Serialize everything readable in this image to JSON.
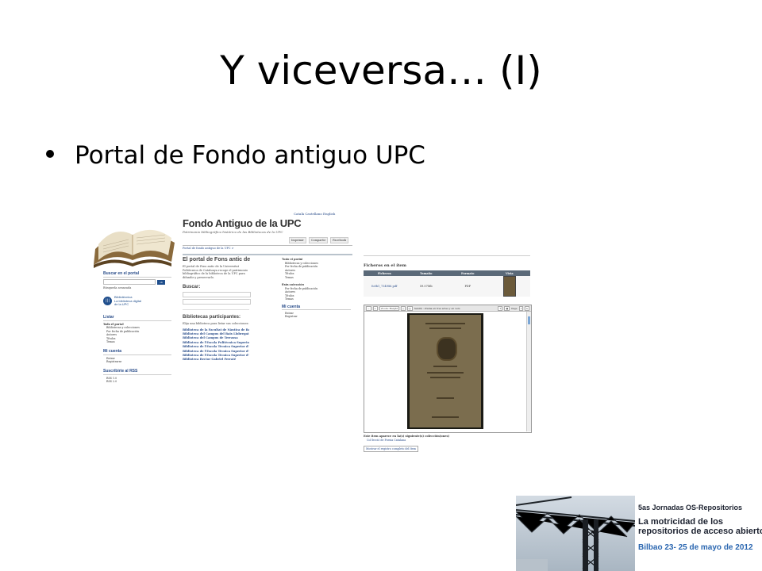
{
  "slide": {
    "title": "Y viceversa… (I)",
    "bullet": "Portal de Fondo antiguo UPC"
  },
  "portal": {
    "lang_links": "Català   Castellano   English",
    "logo_title": "Fondo Antiguo de la UPC",
    "logo_subtitle": "Patrimonio bibliográfico histórico de las Bibliotecas de la UPC",
    "social": [
      "Imprimir",
      "Compartir",
      "Facebook"
    ],
    "breadcrumb": "Portal de fondo antiguo de la UPC >",
    "left_sidebar": {
      "search_heading": "Buscar en el portal",
      "search_go": "ok",
      "advanced_search": "Búsqueda avanzada",
      "bibliotecnica_lines": [
        "Bibliotècnica",
        "La biblioteca digital",
        "de la UPC"
      ],
      "list_heading": "Listar",
      "list_items": [
        "Todo el portal",
        "Bibliotecas y colecciones",
        "Por fecha de publicación",
        "Autores",
        "Títulos",
        "Temas"
      ],
      "account_heading": "Mi cuenta",
      "account_items": [
        "Entrar",
        "Registrarse"
      ],
      "rss_heading": "Suscribirte al RSS",
      "rss_items": [
        "RSS 1.0",
        "RSS 2.0"
      ]
    },
    "main": {
      "portal_title": "El portal de Fons antic de",
      "portal_text": "El portal de Fons antic de la Universitat Politècnica de Catalunya recoge el patrimonio bibliográfico de la biblioteca de la UPC para difundir y preservarlo.",
      "search_label": "Buscar:",
      "libraries_title": "Bibliotecas participantes:",
      "libraries_intro": "Elija una biblioteca para listar sus colecciones:",
      "libraries": [
        "Biblioteca de la Facultat de Nàutica de Barcelona",
        "Biblioteca del Campus del Baix Llobregat",
        "Biblioteca del Campus de Terrassa",
        "Biblioteca de l'Escola Politècnica Superior",
        "Biblioteca de l'Escola Tècnica Superior d'Arquitectura",
        "Biblioteca de l'Escola Tècnica Superior d'Enginyeria",
        "Biblioteca de l'Escola Tècnica Superior d'Enginyers",
        "Biblioteca Rector Gabriel Ferraté"
      ]
    },
    "right_sidebar": {
      "all_heading": "Todo el portal",
      "all_items": [
        "Bibliotecas y colecciones",
        "Por fecha de publicación",
        "Autores",
        "Títulos",
        "Temas"
      ],
      "this_heading": "Esta colección",
      "this_items": [
        "Por fecha de publicación",
        "Autores",
        "Títulos",
        "Temas"
      ],
      "account_heading": "Mi cuenta",
      "account_items": [
        "Entrar",
        "Registrar"
      ]
    }
  },
  "item": {
    "files_title": "Ficheros en el ítem",
    "columns": [
      "Ficheros",
      "Tamaño",
      "Formato",
      "Vista"
    ],
    "row": {
      "file": "fo0b1_734986.pdf",
      "size": "59.07Mb",
      "format": "PDF"
    },
    "viewer": {
      "zoom": "Zoom: Height",
      "page_title": "Sanitá : drama en tres actes y en vers",
      "page_label": "Page",
      "page_num": "1"
    },
    "collections_note": "Este ítem aparece en la(s) siguiente(s) colección(ones)",
    "collection_link": "Col·lecció de Poesia Catalana",
    "full_record": "Mostrar el registro completo del ítem"
  },
  "banner": {
    "line1": "5as Jornadas OS-Repositorios",
    "line2": "La motricidad de los",
    "line3": "repositorios de acceso abierto",
    "line4": "Bilbao 23- 25 de mayo de 2012"
  }
}
